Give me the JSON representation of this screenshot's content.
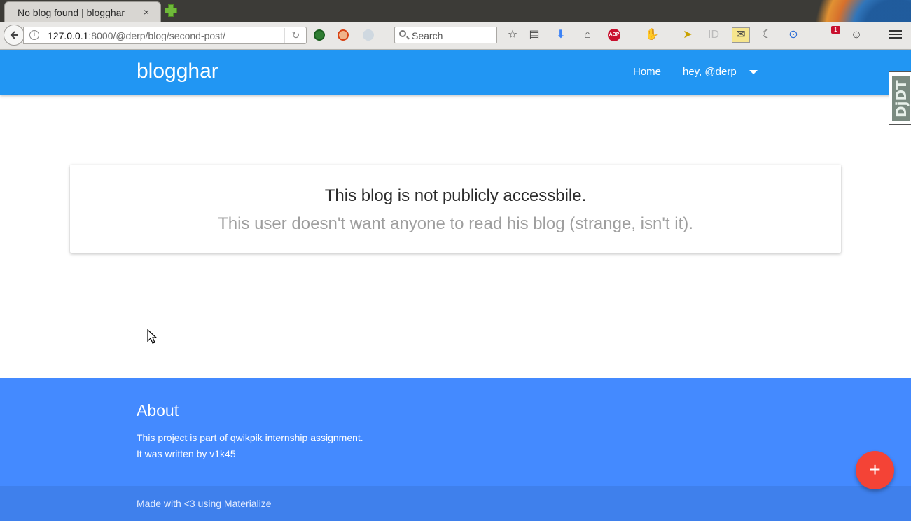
{
  "browser": {
    "tab_title": "No blog found | blogghar",
    "tab_close": "×",
    "url_host": "127.0.0.1",
    "url_rest": ":8000/@derp/blog/second-post/",
    "search_placeholder": "Search",
    "abp_label": "ABP",
    "notification_count": "1"
  },
  "site": {
    "brand": "blogghar",
    "nav": {
      "home": "Home",
      "user": "hey, @derp"
    },
    "djdt_label": "DjDT"
  },
  "message": {
    "title": "This blog is not publicly accessbile.",
    "subtitle": "This user doesn't want anyone to read his blog (strange, isn't it)."
  },
  "footer": {
    "about_title": "About",
    "about_line1": "This project is part of qwikpik internship assignment.",
    "about_line2": "It was written by v1k45",
    "copyright": "Made with <3 using Materialize"
  },
  "fab": {
    "label": "+"
  },
  "colors": {
    "nav_blue": "#2196f3",
    "footer_blue": "#448aff",
    "fab_red": "#f44336"
  }
}
